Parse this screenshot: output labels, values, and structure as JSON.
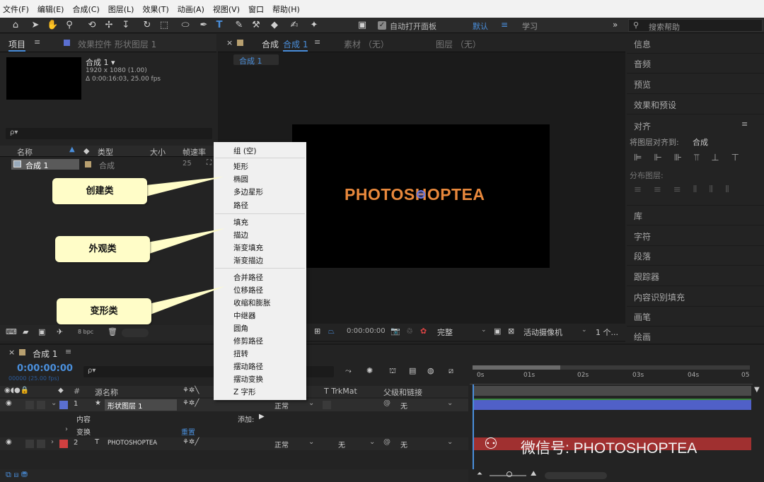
{
  "menubar": {
    "items": [
      "文件(F)",
      "编辑(E)",
      "合成(C)",
      "图层(L)",
      "效果(T)",
      "动画(A)",
      "视图(V)",
      "窗口",
      "帮助(H)"
    ]
  },
  "toolbar": {
    "auto_open_label": "自动打开面板",
    "workspace_default": "默认",
    "workspace_learn": "学习",
    "search_placeholder": "搜索帮助"
  },
  "project_panel": {
    "tab_project": "项目",
    "tab_effects": "效果控件 形状图层 1",
    "comp_name": "合成 1 ▾",
    "comp_size": "1920 x 1080 (1.00)",
    "comp_duration": "Δ 0:00:16:03, 25.00 fps",
    "search_placeholder": "ρ▾",
    "columns": {
      "name": "名称",
      "type": "类型",
      "size": "大小",
      "fps": "帧速率"
    },
    "rows": [
      {
        "name": "合成 1",
        "type": "合成",
        "fps": "25"
      }
    ],
    "bpc": "8 bpc"
  },
  "viewer": {
    "tab_comp": "合成",
    "tab_comp_active": "合成 1",
    "tab_footage": "素材 （无）",
    "tab_layer": "图层 （无）",
    "breadcrumb": "合成 1",
    "canvas_text": "PHOTOSHOPTEA",
    "timecode": "0:00:00:00",
    "quality": "完整",
    "camera": "活动摄像机",
    "views": "1 个..."
  },
  "right_panel": {
    "items": [
      "信息",
      "音频",
      "预览",
      "效果和预设",
      "对齐",
      "库",
      "字符",
      "段落",
      "跟踪器",
      "内容识别填充",
      "画笔",
      "绘画"
    ],
    "align_to_label": "将图层对齐到:",
    "align_to_value": "合成",
    "distribute_label": "分布图层:"
  },
  "context_menu": {
    "group1": [
      "组 (空)"
    ],
    "group2": [
      "矩形",
      "椭圆",
      "多边星形",
      "路径"
    ],
    "group3": [
      "填充",
      "描边",
      "渐变填充",
      "渐变描边"
    ],
    "group4": [
      "合并路径",
      "位移路径",
      "收缩和膨胀",
      "中继器",
      "圆角",
      "修剪路径",
      "扭转",
      "摆动路径",
      "摆动变换",
      "Z 字形"
    ]
  },
  "callouts": {
    "create": "创建类",
    "appearance": "外观类",
    "transform": "变形类"
  },
  "timeline": {
    "tab": "合成 1",
    "timecode": "0:00:00:00",
    "frame_info": "00000 (25.00 fps)",
    "search_placeholder": "ρ▾",
    "col_num": "#",
    "col_source": "源名称",
    "col_trkmat": "T  TrkMat",
    "col_parent": "父级和链接",
    "ruler": [
      "0s",
      "01s",
      "02s",
      "03s",
      "04s",
      "05"
    ],
    "layers": [
      {
        "num": "1",
        "name": "形状图层 1",
        "mode": "正常",
        "parent": "无"
      },
      {
        "num": "2",
        "name": "PHOTOSHOPTEA",
        "mode": "正常",
        "trkmat": "无",
        "parent": "无"
      }
    ],
    "content_label": "内容",
    "add_label": "添加:",
    "transform_label": "变换",
    "reset_label": "重置"
  },
  "watermark": "微信号: PHOTOSHOPTEA",
  "colors": {
    "accent": "#4a8fdc",
    "orange_text": "#e8883c",
    "layer1": "#5a6fd0",
    "layer2": "#d04040",
    "bar_blue": "#5060c8",
    "bar_red": "#a03030"
  }
}
